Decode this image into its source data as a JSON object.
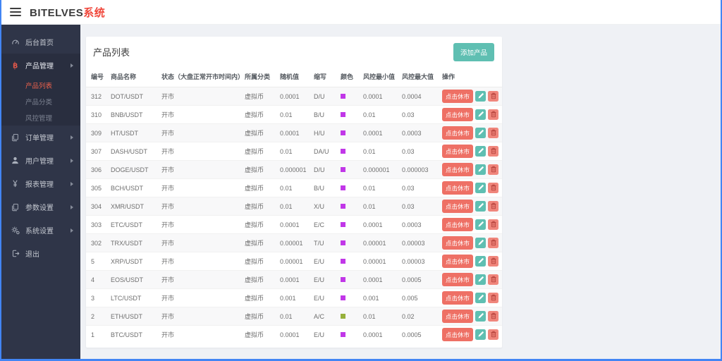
{
  "header": {
    "brand": "BITELVES",
    "brand_suffix": "系统"
  },
  "sidebar": {
    "items": [
      {
        "key": "dashboard",
        "label": "后台首页",
        "icon": "gauge-icon",
        "arrow": false
      },
      {
        "key": "product-management",
        "label": "产品管理",
        "icon": "bitcoin-icon",
        "arrow": true,
        "expanded": true,
        "children": [
          {
            "key": "product-list",
            "label": "产品列表",
            "active": true
          },
          {
            "key": "product-category",
            "label": "产品分类",
            "active": false
          },
          {
            "key": "risk-management",
            "label": "风控管理",
            "active": false
          }
        ]
      },
      {
        "key": "order-management",
        "label": "订单管理",
        "icon": "copy-icon",
        "arrow": true
      },
      {
        "key": "user-management",
        "label": "用户管理",
        "icon": "user-icon",
        "arrow": true
      },
      {
        "key": "report-management",
        "label": "报表管理",
        "icon": "yen-icon",
        "arrow": true
      },
      {
        "key": "parameter-settings",
        "label": "参数设置",
        "icon": "copy-icon",
        "arrow": true
      },
      {
        "key": "system-settings",
        "label": "系统设置",
        "icon": "gear-icon",
        "arrow": true
      },
      {
        "key": "logout",
        "label": "退出",
        "icon": "logout-icon",
        "arrow": false
      }
    ]
  },
  "main": {
    "card_title": "产品列表",
    "add_button_label": "添加产品",
    "table": {
      "headers": [
        "编号",
        "商品名称",
        "状态（大盘正常开市时间内）",
        "所属分类",
        "随机值",
        "缩写",
        "颜色",
        "风控最小值",
        "风控最大值",
        "操作"
      ],
      "actions": {
        "close_market_label": "点击休市",
        "edit_icon": "pencil-icon",
        "delete_icon": "trash-icon"
      },
      "rows": [
        {
          "id": "312",
          "name": "DOT/USDT",
          "status": "开市",
          "category": "虚拟币",
          "random": "0.0001",
          "abbr": "D/U",
          "color": "#c137e8",
          "risk_min": "0.0001",
          "risk_max": "0.0004"
        },
        {
          "id": "310",
          "name": "BNB/USDT",
          "status": "开市",
          "category": "虚拟币",
          "random": "0.01",
          "abbr": "B/U",
          "color": "#c137e8",
          "risk_min": "0.01",
          "risk_max": "0.03"
        },
        {
          "id": "309",
          "name": "HT/USDT",
          "status": "开市",
          "category": "虚拟币",
          "random": "0.0001",
          "abbr": "H/U",
          "color": "#c137e8",
          "risk_min": "0.0001",
          "risk_max": "0.0003"
        },
        {
          "id": "307",
          "name": "DASH/USDT",
          "status": "开市",
          "category": "虚拟币",
          "random": "0.01",
          "abbr": "DA/U",
          "color": "#c137e8",
          "risk_min": "0.01",
          "risk_max": "0.03"
        },
        {
          "id": "306",
          "name": "DOGE/USDT",
          "status": "开市",
          "category": "虚拟币",
          "random": "0.000001",
          "abbr": "D/U",
          "color": "#c137e8",
          "risk_min": "0.000001",
          "risk_max": "0.000003"
        },
        {
          "id": "305",
          "name": "BCH/USDT",
          "status": "开市",
          "category": "虚拟币",
          "random": "0.01",
          "abbr": "B/U",
          "color": "#c137e8",
          "risk_min": "0.01",
          "risk_max": "0.03"
        },
        {
          "id": "304",
          "name": "XMR/USDT",
          "status": "开市",
          "category": "虚拟币",
          "random": "0.01",
          "abbr": "X/U",
          "color": "#c137e8",
          "risk_min": "0.01",
          "risk_max": "0.03"
        },
        {
          "id": "303",
          "name": "ETC/USDT",
          "status": "开市",
          "category": "虚拟币",
          "random": "0.0001",
          "abbr": "E/C",
          "color": "#c137e8",
          "risk_min": "0.0001",
          "risk_max": "0.0003"
        },
        {
          "id": "302",
          "name": "TRX/USDT",
          "status": "开市",
          "category": "虚拟币",
          "random": "0.00001",
          "abbr": "T/U",
          "color": "#c137e8",
          "risk_min": "0.00001",
          "risk_max": "0.00003"
        },
        {
          "id": "5",
          "name": "XRP/USDT",
          "status": "开市",
          "category": "虚拟币",
          "random": "0.00001",
          "abbr": "E/U",
          "color": "#c137e8",
          "risk_min": "0.00001",
          "risk_max": "0.00003"
        },
        {
          "id": "4",
          "name": "EOS/USDT",
          "status": "开市",
          "category": "虚拟币",
          "random": "0.0001",
          "abbr": "E/U",
          "color": "#c137e8",
          "risk_min": "0.0001",
          "risk_max": "0.0005"
        },
        {
          "id": "3",
          "name": "LTC/USDT",
          "status": "开市",
          "category": "虚拟币",
          "random": "0.001",
          "abbr": "E/U",
          "color": "#c137e8",
          "risk_min": "0.001",
          "risk_max": "0.005"
        },
        {
          "id": "2",
          "name": "ETH/USDT",
          "status": "开市",
          "category": "虚拟币",
          "random": "0.01",
          "abbr": "A/C",
          "color": "#97b13c",
          "risk_min": "0.01",
          "risk_max": "0.02"
        },
        {
          "id": "1",
          "name": "BTC/USDT",
          "status": "开市",
          "category": "虚拟币",
          "random": "0.0001",
          "abbr": "E/U",
          "color": "#c137e8",
          "risk_min": "0.0001",
          "risk_max": "0.0005"
        }
      ]
    }
  },
  "colors": {
    "accent_teal": "#5fbfb2",
    "accent_red": "#ee7065",
    "brand_red": "#f0483c",
    "sidebar_bg": "#2f3548",
    "active_item": "#e8604c",
    "swatch_purple": "#c137e8",
    "swatch_olive": "#97b13c"
  }
}
